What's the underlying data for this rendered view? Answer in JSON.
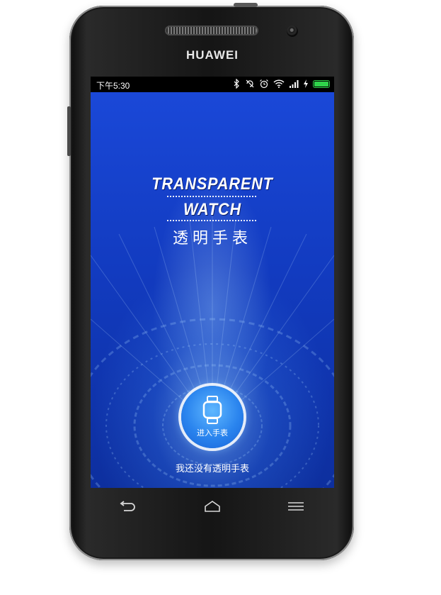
{
  "device": {
    "brand": "HUAWEI"
  },
  "status_bar": {
    "time": "下午5:30",
    "icons": [
      "bluetooth-icon",
      "rotation-lock-icon",
      "alarm-icon",
      "wifi-icon",
      "signal-icon",
      "charging-icon",
      "battery-icon"
    ],
    "battery_color": "#2fd34a"
  },
  "app": {
    "logo_line1": "TRANSPARENT",
    "logo_line2": "WATCH",
    "logo_cn": "透明手表",
    "enter_button_label": "进入手表",
    "no_watch_link": "我还没有透明手表",
    "accent_color": "#2a84ee",
    "background_color": "#123bc0"
  },
  "nav_keys": [
    "back-icon",
    "home-icon",
    "menu-icon"
  ]
}
